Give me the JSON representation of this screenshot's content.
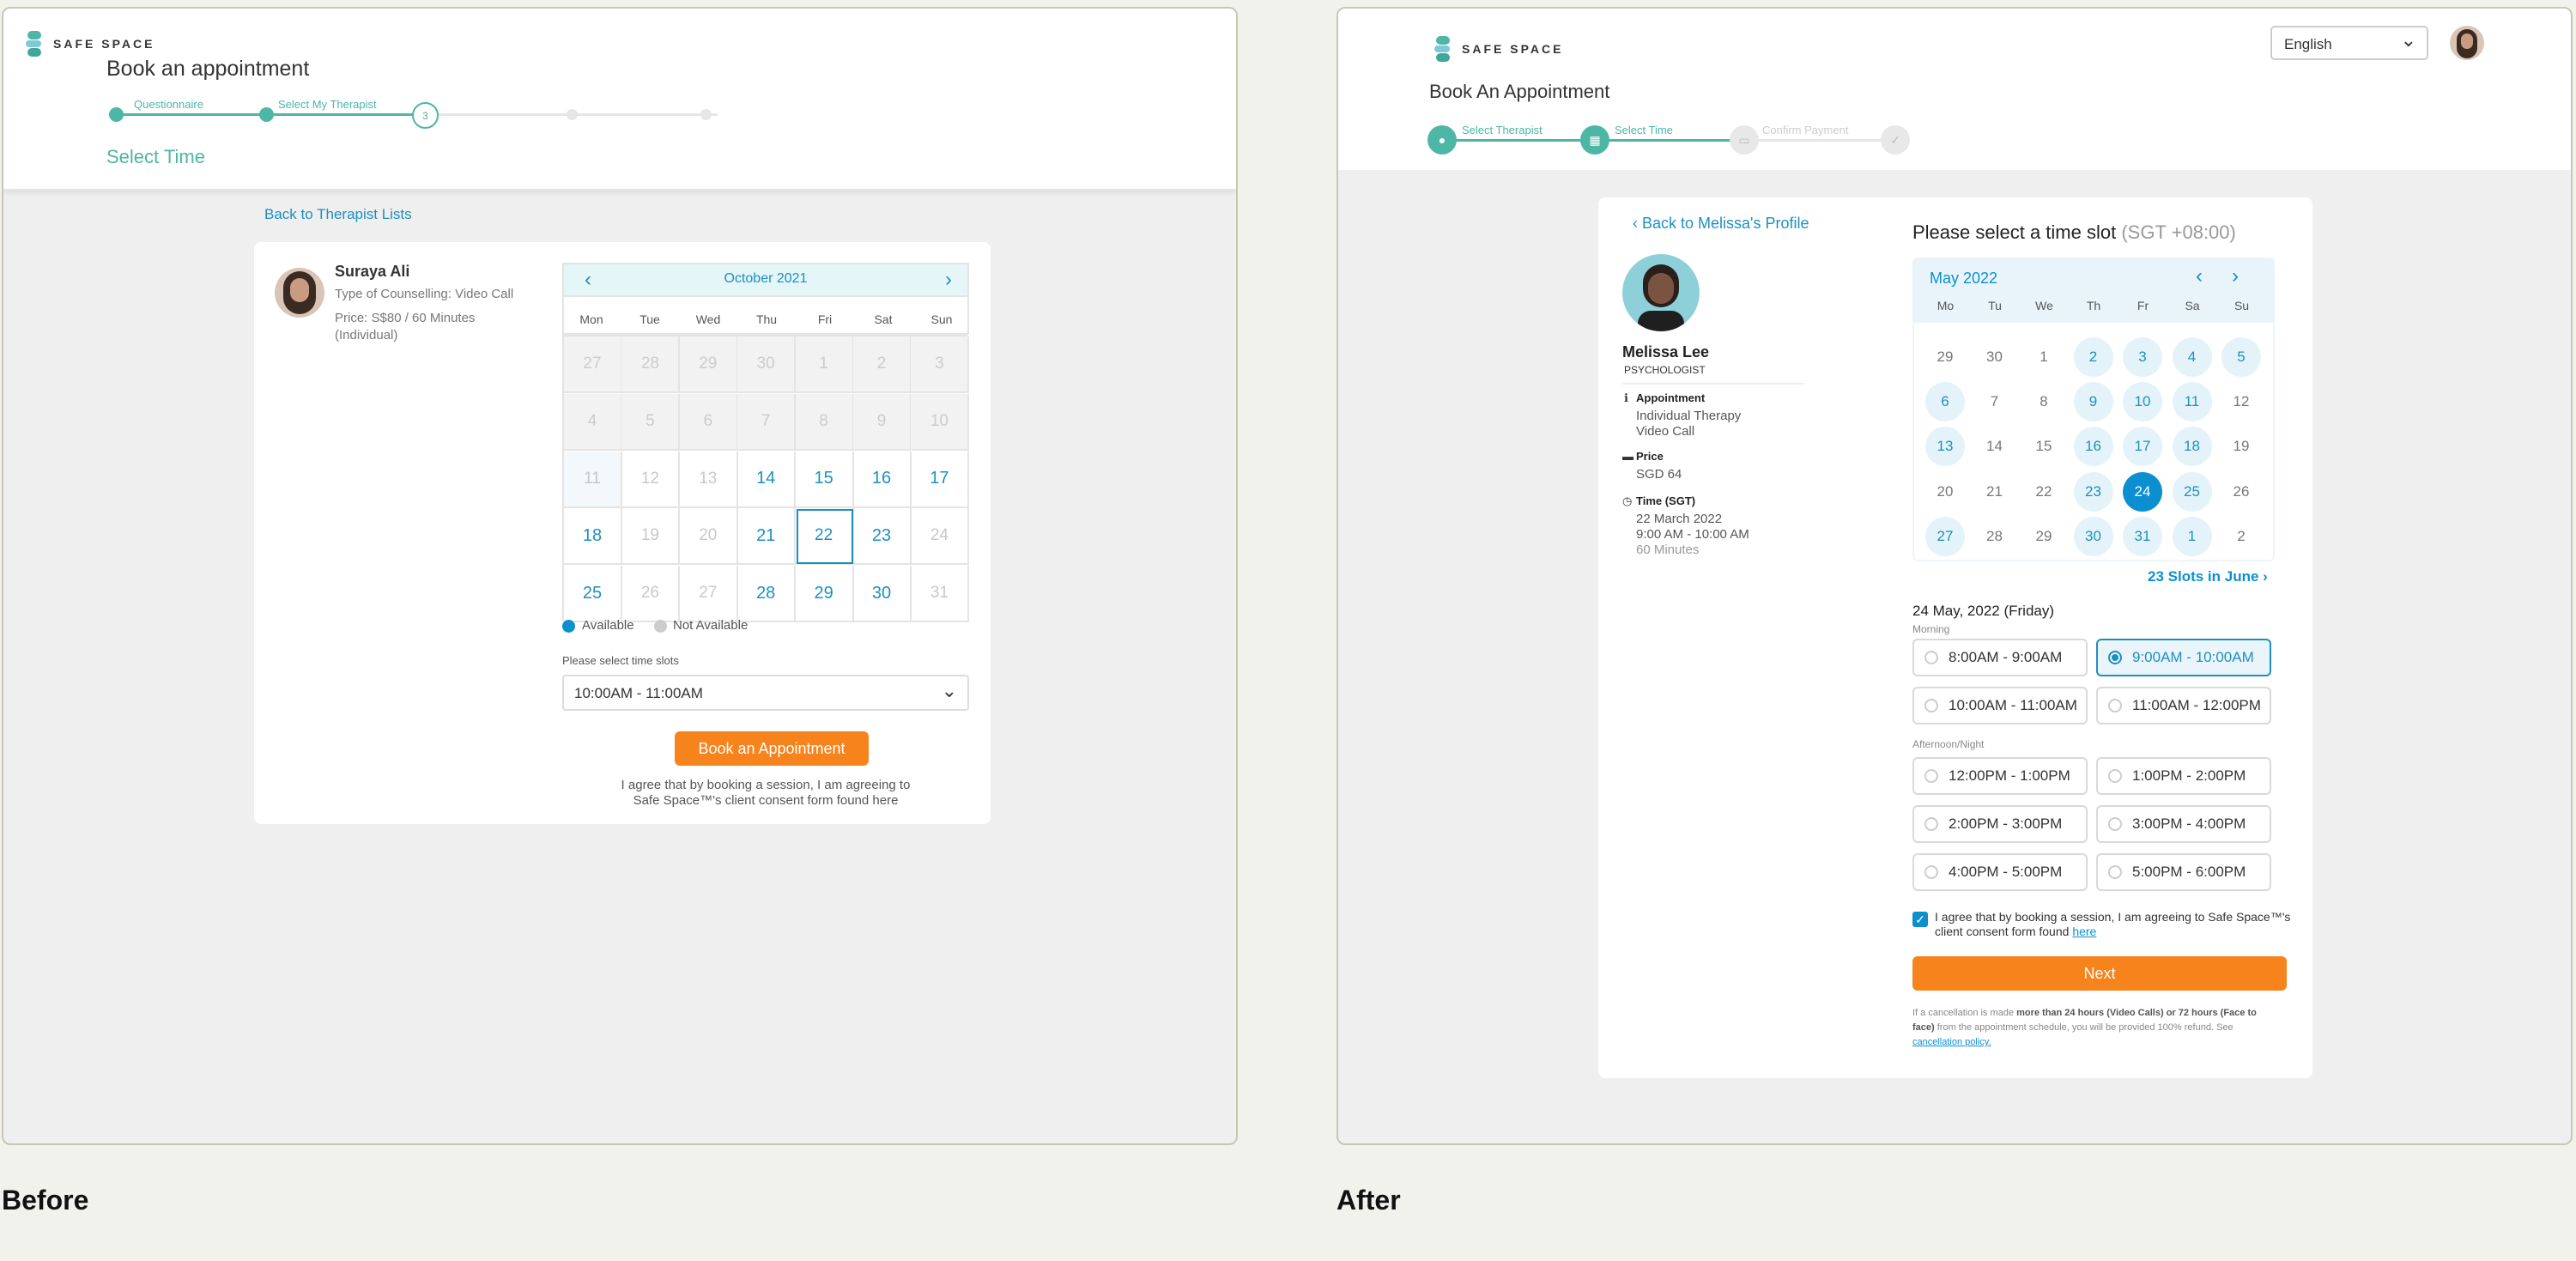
{
  "before": {
    "caption": "Before",
    "brand": "SAFE SPACE",
    "title": "Book an appointment",
    "steps": [
      "Questionnaire",
      "Select My Therapist",
      "3"
    ],
    "section": "Select Time",
    "back_link": "Back to Therapist Lists",
    "therapist": {
      "name": "Suraya Ali",
      "type": "Type of Counselling: Video Call",
      "price": "Price: S$80 / 60 Minutes",
      "price2": "(Individual)"
    },
    "calendar": {
      "month": "October 2021",
      "weekdays": [
        "Mon",
        "Tue",
        "Wed",
        "Thu",
        "Fri",
        "Sat",
        "Sun"
      ],
      "days": [
        [
          {
            "n": "27",
            "s": "na"
          },
          {
            "n": "28",
            "s": "na"
          },
          {
            "n": "29",
            "s": "na"
          },
          {
            "n": "30",
            "s": "na"
          },
          {
            "n": "1",
            "s": "na"
          },
          {
            "n": "2",
            "s": "na"
          },
          {
            "n": "3",
            "s": "na"
          }
        ],
        [
          {
            "n": "4",
            "s": "na"
          },
          {
            "n": "5",
            "s": "na"
          },
          {
            "n": "6",
            "s": "na"
          },
          {
            "n": "7",
            "s": "na"
          },
          {
            "n": "8",
            "s": "na"
          },
          {
            "n": "9",
            "s": "na"
          },
          {
            "n": "10",
            "s": "na"
          }
        ],
        [
          {
            "n": "11",
            "s": "lt"
          },
          {
            "n": "12",
            "s": "dis"
          },
          {
            "n": "13",
            "s": "dis"
          },
          {
            "n": "14",
            "s": "av"
          },
          {
            "n": "15",
            "s": "av"
          },
          {
            "n": "16",
            "s": "av"
          },
          {
            "n": "17",
            "s": "av"
          }
        ],
        [
          {
            "n": "18",
            "s": "av"
          },
          {
            "n": "19",
            "s": "dis"
          },
          {
            "n": "20",
            "s": "dis"
          },
          {
            "n": "21",
            "s": "av"
          },
          {
            "n": "22",
            "s": "sel"
          },
          {
            "n": "23",
            "s": "av"
          },
          {
            "n": "24",
            "s": "dis"
          }
        ],
        [
          {
            "n": "25",
            "s": "av"
          },
          {
            "n": "26",
            "s": "dis"
          },
          {
            "n": "27",
            "s": "dis"
          },
          {
            "n": "28",
            "s": "av"
          },
          {
            "n": "29",
            "s": "av"
          },
          {
            "n": "30",
            "s": "av"
          },
          {
            "n": "31",
            "s": "dis"
          }
        ]
      ]
    },
    "legend": {
      "available": "Available",
      "not_available": "Not Available"
    },
    "slot_label": "Please select time slots",
    "slot_value": "10:00AM - 11:00AM",
    "book_button": "Book an Appointment",
    "consent": [
      "I agree that by booking a session, I am agreeing to",
      "Safe Space™'s client consent form found here"
    ],
    "colors": {
      "teal": "#4db6a5",
      "blue": "#1d8fbf",
      "orange": "#f7831c"
    }
  },
  "after": {
    "caption": "After",
    "brand": "SAFE SPACE",
    "language": "English",
    "title": "Book An Appointment",
    "steps": [
      "Select Therapist",
      "Select Time",
      "Confirm Payment"
    ],
    "back_link": "Back to Melissa's Profile",
    "therapist": {
      "name": "Melissa Lee",
      "role": "PSYCHOLOGIST",
      "appt_label": "Appointment",
      "appt_lines": [
        "Individual Therapy",
        "Video Call"
      ],
      "price_label": "Price",
      "price": "SGD 64",
      "time_label": "Time (SGT)",
      "time_lines": [
        "22 March 2022",
        "9:00 AM - 10:00 AM"
      ],
      "duration": "60 Minutes"
    },
    "heading": "Please select a time slot",
    "tz": "(SGT +08:00)",
    "calendar": {
      "month": "May 2022",
      "weekdays": [
        "Mo",
        "Tu",
        "We",
        "Th",
        "Fr",
        "Sa",
        "Su"
      ],
      "days": [
        [
          {
            "n": "29",
            "s": "x"
          },
          {
            "n": "30",
            "s": "x"
          },
          {
            "n": "1",
            "s": "x"
          },
          {
            "n": "2",
            "s": "av"
          },
          {
            "n": "3",
            "s": "av"
          },
          {
            "n": "4",
            "s": "av"
          },
          {
            "n": "5",
            "s": "av"
          }
        ],
        [
          {
            "n": "6",
            "s": "av"
          },
          {
            "n": "7",
            "s": "x"
          },
          {
            "n": "8",
            "s": "x"
          },
          {
            "n": "9",
            "s": "av"
          },
          {
            "n": "10",
            "s": "av"
          },
          {
            "n": "11",
            "s": "av"
          },
          {
            "n": "12",
            "s": "x"
          }
        ],
        [
          {
            "n": "13",
            "s": "av"
          },
          {
            "n": "14",
            "s": "x"
          },
          {
            "n": "15",
            "s": "x"
          },
          {
            "n": "16",
            "s": "av"
          },
          {
            "n": "17",
            "s": "av"
          },
          {
            "n": "18",
            "s": "av"
          },
          {
            "n": "19",
            "s": "x"
          }
        ],
        [
          {
            "n": "20",
            "s": "x"
          },
          {
            "n": "21",
            "s": "x"
          },
          {
            "n": "22",
            "s": "x"
          },
          {
            "n": "23",
            "s": "av"
          },
          {
            "n": "24",
            "s": "sel"
          },
          {
            "n": "25",
            "s": "av"
          },
          {
            "n": "26",
            "s": "x"
          }
        ],
        [
          {
            "n": "27",
            "s": "av"
          },
          {
            "n": "28",
            "s": "x"
          },
          {
            "n": "29",
            "s": "x"
          },
          {
            "n": "30",
            "s": "av"
          },
          {
            "n": "31",
            "s": "av"
          },
          {
            "n": "1",
            "s": "av"
          },
          {
            "n": "2",
            "s": "x"
          }
        ]
      ]
    },
    "next_month": "23 Slots in June",
    "selected_date": "24 May, 2022 (Friday)",
    "morning_label": "Morning",
    "afternoon_label": "Afternoon/Night",
    "slots": [
      {
        "t": "8:00AM - 9:00AM",
        "on": false
      },
      {
        "t": "9:00AM - 10:00AM",
        "on": true
      },
      {
        "t": "10:00AM - 11:00AM",
        "on": false
      },
      {
        "t": "11:00AM - 12:00PM",
        "on": false
      },
      {
        "t": "12:00PM - 1:00PM",
        "on": false
      },
      {
        "t": "1:00PM - 2:00PM",
        "on": false
      },
      {
        "t": "2:00PM - 3:00PM",
        "on": false
      },
      {
        "t": "3:00PM - 4:00PM",
        "on": false
      },
      {
        "t": "4:00PM - 5:00PM",
        "on": false
      },
      {
        "t": "5:00PM - 6:00PM",
        "on": false
      }
    ],
    "consent_a": "I agree that by booking a session, I am agreeing to Safe Space™'s",
    "consent_b": "client consent form found ",
    "consent_link": "here",
    "next_button": "Next",
    "cancel_a": "If a cancellation is made ",
    "cancel_b": "more than 24 hours (Video Calls) or 72 hours (Face to",
    "cancel_c": "face)",
    "cancel_d": " from the appointment schedule, you will be provided 100% refund. See",
    "cancel_link": "cancellation policy.",
    "colors": {
      "teal": "#4db6a5",
      "blue": "#0c8fd1",
      "orange": "#f7831c"
    }
  }
}
